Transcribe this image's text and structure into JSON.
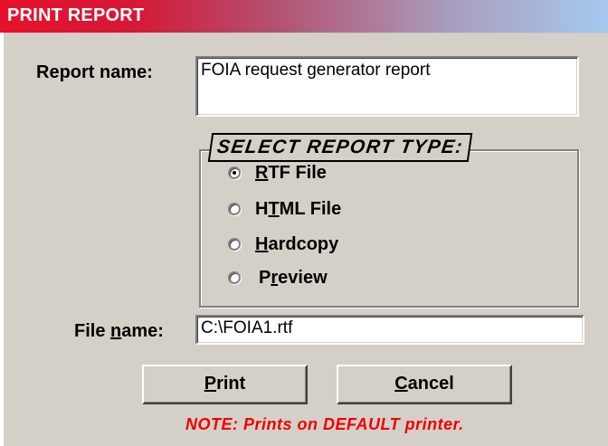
{
  "window": {
    "title": "PRINT REPORT"
  },
  "report": {
    "label": "Report name:",
    "value": "FOIA request generator report"
  },
  "report_type": {
    "legend": "SELECT REPORT TYPE:",
    "options": [
      {
        "pre": "",
        "mn": "R",
        "post": "TF File",
        "selected": true
      },
      {
        "pre": "H",
        "mn": "T",
        "post": "ML File",
        "selected": false
      },
      {
        "pre": "",
        "mn": "H",
        "post": "ardcopy",
        "selected": false
      },
      {
        "pre": "P",
        "mn": "r",
        "post": "eview",
        "selected": false
      }
    ]
  },
  "file": {
    "label_pre": "File ",
    "label_mn": "n",
    "label_post": "ame:",
    "value": "C:\\FOIA1.rtf"
  },
  "buttons": {
    "print": {
      "mn": "P",
      "rest": "rint"
    },
    "cancel": {
      "mn": "C",
      "rest": "ancel"
    }
  },
  "note": "NOTE: Prints on DEFAULT printer."
}
